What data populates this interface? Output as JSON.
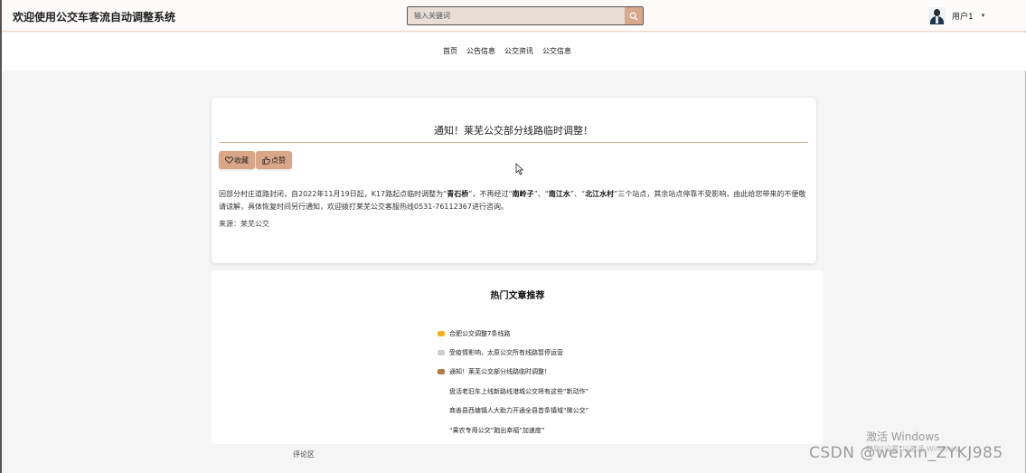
{
  "header": {
    "site_title": "欢迎使用公交车客流自动调整系统",
    "search_placeholder": "输入关键词",
    "user_name": "用户1",
    "caret": "▾"
  },
  "nav": {
    "links": [
      "首页",
      "公告信息",
      "公交资讯",
      "公交信息"
    ]
  },
  "article": {
    "title": "通知！莱芜公交部分线路临时调整！",
    "favorite_label": "收藏",
    "like_label": "点赞",
    "content_parts": [
      "因部分村庄道路封闭，自2022年11月19日起，K17路起点临时调整为“",
      "青石桥",
      "”，不再经过“",
      "南岭子",
      "”、“",
      "南江水",
      "”、“",
      "北江水村",
      "”三个站点，其余站点停靠不受影响，由此给您带来的不便敬请谅解，具体恢复时间另行通知，欢迎拨打莱芜公交客服热线0531-76112367进行咨询。"
    ],
    "source": "来源：莱芜公交"
  },
  "hot": {
    "title": "热门文章推荐",
    "items": [
      "合肥公交调整7条线路",
      "受疫情影响，太原公交所有线路暂停运营",
      "通知！莱芜公交部分线路临时调整！",
      "盘活老旧车上线新路线港城公交将有这些“新动作”",
      "商善县西塘镇人大助力开通全县首条镇域“微公交”",
      "“果农专用公交”跑出幸福“加速度”"
    ]
  },
  "comment_label": "评论区",
  "watermark": {
    "activate_main": "激活 Windows",
    "activate_sub": "转到“设置”以激活 Windows。",
    "csdn": "CSDN @weixin_ZYKJ985"
  },
  "colors": {
    "accent": "#d9a688",
    "search_bg": "#e9ddd4",
    "divider": "#d7b49d"
  }
}
